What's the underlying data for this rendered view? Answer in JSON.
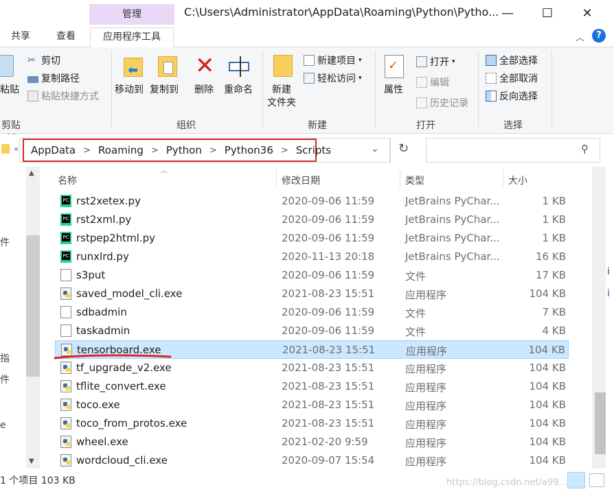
{
  "window": {
    "title": "C:\\Users\\Administrator\\AppData\\Roaming\\Python\\Pytho...",
    "contextual_group": "管理",
    "minimize": "—",
    "maximize": "☐",
    "close": "✕"
  },
  "ribbon_tabs": [
    "共享",
    "查看",
    "应用程序工具"
  ],
  "ribbon": {
    "clipboard": {
      "label": "剪贴板",
      "paste_partial": "粘贴",
      "cut": "剪切",
      "copy_path": "复制路径",
      "paste_shortcut": "粘贴快捷方式"
    },
    "organize": {
      "label": "组织",
      "move_to": "移动到",
      "copy_to": "复制到",
      "delete": "删除",
      "rename": "重命名"
    },
    "new": {
      "label": "新建",
      "new_folder_1": "新建",
      "new_folder_2": "文件夹",
      "new_item": "新建项目",
      "easy_access": "轻松访问"
    },
    "open": {
      "label": "打开",
      "properties": "属性",
      "open": "打开",
      "edit": "编辑",
      "history": "历史记录"
    },
    "select": {
      "label": "选择",
      "select_all": "全部选择",
      "select_none": "全部取消",
      "invert": "反向选择"
    }
  },
  "address": {
    "crumbs": [
      "AppData",
      "Roaming",
      "Python",
      "Python36",
      "Scripts"
    ],
    "search_placeholder": ""
  },
  "columns": {
    "name": "名称",
    "date": "修改日期",
    "type": "类型",
    "size": "大小"
  },
  "files": [
    {
      "name": "rst2xetex.py",
      "date": "2020-09-06 11:59",
      "type": "JetBrains PyChar...",
      "size": "1 KB",
      "icon": "pycharm-icon"
    },
    {
      "name": "rst2xml.py",
      "date": "2020-09-06 11:59",
      "type": "JetBrains PyChar...",
      "size": "1 KB",
      "icon": "pycharm-icon"
    },
    {
      "name": "rstpep2html.py",
      "date": "2020-09-06 11:59",
      "type": "JetBrains PyChar...",
      "size": "1 KB",
      "icon": "pycharm-icon"
    },
    {
      "name": "runxlrd.py",
      "date": "2020-11-13 20:18",
      "type": "JetBrains PyChar...",
      "size": "16 KB",
      "icon": "pycharm-icon"
    },
    {
      "name": "s3put",
      "date": "2020-09-06 11:59",
      "type": "文件",
      "size": "17 KB",
      "icon": "file-icon"
    },
    {
      "name": "saved_model_cli.exe",
      "date": "2021-08-23 15:51",
      "type": "应用程序",
      "size": "104 KB",
      "icon": "python-exe-icon"
    },
    {
      "name": "sdbadmin",
      "date": "2020-09-06 11:59",
      "type": "文件",
      "size": "7 KB",
      "icon": "file-icon"
    },
    {
      "name": "taskadmin",
      "date": "2020-09-06 11:59",
      "type": "文件",
      "size": "4 KB",
      "icon": "file-icon"
    },
    {
      "name": "tensorboard.exe",
      "date": "2021-08-23 15:51",
      "type": "应用程序",
      "size": "104 KB",
      "icon": "python-exe-icon",
      "selected": true
    },
    {
      "name": "tf_upgrade_v2.exe",
      "date": "2021-08-23 15:51",
      "type": "应用程序",
      "size": "104 KB",
      "icon": "python-exe-icon"
    },
    {
      "name": "tflite_convert.exe",
      "date": "2021-08-23 15:51",
      "type": "应用程序",
      "size": "104 KB",
      "icon": "python-exe-icon"
    },
    {
      "name": "toco.exe",
      "date": "2021-08-23 15:51",
      "type": "应用程序",
      "size": "104 KB",
      "icon": "python-exe-icon"
    },
    {
      "name": "toco_from_protos.exe",
      "date": "2021-08-23 15:51",
      "type": "应用程序",
      "size": "104 KB",
      "icon": "python-exe-icon"
    },
    {
      "name": "wheel.exe",
      "date": "2021-02-20 9:59",
      "type": "应用程序",
      "size": "104 KB",
      "icon": "python-exe-icon"
    },
    {
      "name": "wordcloud_cli.exe",
      "date": "2020-09-07 15:54",
      "type": "应用程序",
      "size": "104 KB",
      "icon": "python-exe-icon"
    }
  ],
  "status": {
    "text": "1 个项目  103 KB"
  },
  "watermark": "https://blog.csdn.net/a99…",
  "left_edge_chars": [
    "件",
    "指",
    "件",
    "e"
  ],
  "right_edge_chars": [
    "i",
    "i"
  ],
  "colors": {
    "accent_selection": "#cce8ff",
    "highlight_red": "#d9262a",
    "manage_tab": "#e9d9f7"
  }
}
